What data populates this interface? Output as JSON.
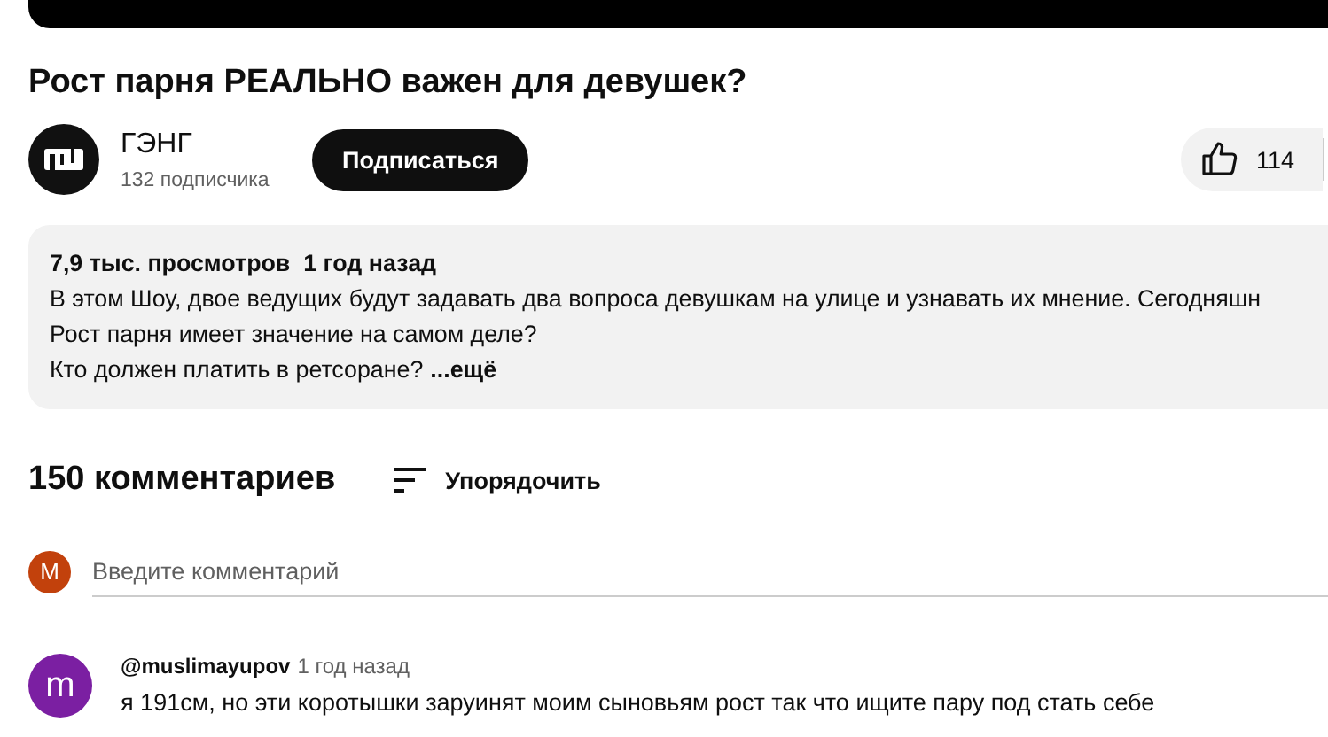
{
  "video": {
    "kind": "player"
  },
  "title": "Рост парня РЕАЛЬНО важен для девушек?",
  "channel": {
    "name": "ГЭНГ",
    "subscribers": "132 подписчика",
    "subscribe_label": "Подписаться"
  },
  "likes": {
    "count": "114"
  },
  "description": {
    "stats": "7,9 тыс. просмотров  1 год назад",
    "lines": [
      "В этом Шоу, двое ведущих будут задавать два вопроса девушкам на улице и узнавать их мнение. Сегодняшн",
      "Рост парня имеет значение на самом деле?",
      "Кто должен платить в ретсоране?"
    ],
    "more": "...ещё"
  },
  "comments_header": {
    "count": "150 комментариев",
    "sort": "Упорядочить"
  },
  "comment_input": {
    "avatar_letter": "M",
    "color": "#c2410c",
    "placeholder": "Введите комментарий"
  },
  "comments": [
    {
      "avatar_letter": "m",
      "color": "#7b1fa2",
      "author": "@muslimayupov",
      "time": "1 год назад",
      "text": "я 191см, но эти коротышки заруинят моим сыновьям рост так что ищите пару под стать себе"
    }
  ]
}
